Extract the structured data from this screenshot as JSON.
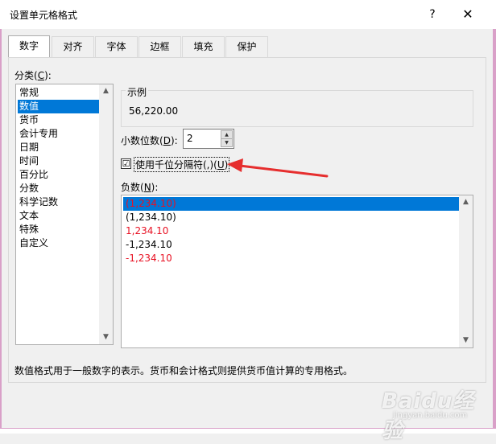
{
  "dialog": {
    "title": "设置单元格格式",
    "help_label": "?",
    "close_label": "✕"
  },
  "tabs": [
    {
      "label": "数字",
      "active": true
    },
    {
      "label": "对齐"
    },
    {
      "label": "字体"
    },
    {
      "label": "边框"
    },
    {
      "label": "填充"
    },
    {
      "label": "保护"
    }
  ],
  "category": {
    "label_main": "分类(",
    "label_key": "C",
    "label_tail": "):",
    "items": [
      "常规",
      "数值",
      "货币",
      "会计专用",
      "日期",
      "时间",
      "百分比",
      "分数",
      "科学记数",
      "文本",
      "特殊",
      "自定义"
    ],
    "selected_index": 1
  },
  "sample": {
    "label": "示例",
    "value": "56,220.00"
  },
  "decimals": {
    "label_main": "小数位数(",
    "label_key": "D",
    "label_tail": "):",
    "value": "2"
  },
  "thousands": {
    "checked": true,
    "check_mark": "☑",
    "label_main": "使用千位分隔符(,)(",
    "label_key": "U",
    "label_tail": ")"
  },
  "negative": {
    "label_main": "负数(",
    "label_key": "N",
    "label_tail": "):",
    "items": [
      {
        "text": "(1,234.10)",
        "color": "#e81123",
        "selected": true
      },
      {
        "text": "(1,234.10)",
        "color": "#000000"
      },
      {
        "text": "1,234.10",
        "color": "#e81123"
      },
      {
        "text": "-1,234.10",
        "color": "#000000"
      },
      {
        "text": "-1,234.10",
        "color": "#e81123"
      }
    ]
  },
  "description": "数值格式用于一般数字的表示。货币和会计格式则提供货币值计算的专用格式。",
  "annotation": {
    "arrow_color": "#e62e2e"
  },
  "watermark": {
    "logo": "Baidu经验",
    "url": "jingyan.baidu.com"
  }
}
